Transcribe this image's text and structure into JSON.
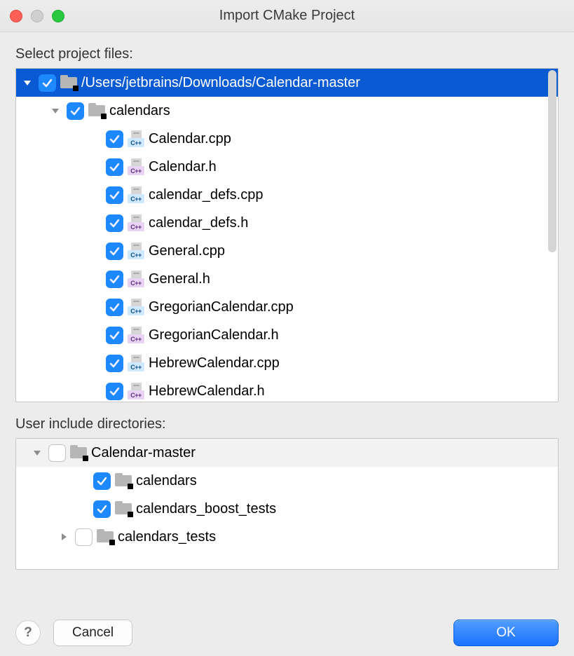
{
  "window": {
    "title": "Import CMake Project"
  },
  "sections": {
    "project_files_label": "Select project files:",
    "include_dirs_label": "User include directories:"
  },
  "project_tree": {
    "root": {
      "label": "/Users/jetbrains/Downloads/Calendar-master",
      "checked": true,
      "folders": [
        {
          "label": "calendars",
          "checked": true,
          "files": [
            {
              "label": "Calendar.cpp",
              "type": "cpp",
              "checked": true
            },
            {
              "label": "Calendar.h",
              "type": "h",
              "checked": true
            },
            {
              "label": "calendar_defs.cpp",
              "type": "cpp",
              "checked": true
            },
            {
              "label": "calendar_defs.h",
              "type": "h",
              "checked": true
            },
            {
              "label": "General.cpp",
              "type": "cpp",
              "checked": true
            },
            {
              "label": "General.h",
              "type": "h",
              "checked": true
            },
            {
              "label": "GregorianCalendar.cpp",
              "type": "cpp",
              "checked": true
            },
            {
              "label": "GregorianCalendar.h",
              "type": "h",
              "checked": true
            },
            {
              "label": "HebrewCalendar.cpp",
              "type": "cpp",
              "checked": true
            },
            {
              "label": "HebrewCalendar.h",
              "type": "h",
              "checked": true
            }
          ]
        }
      ]
    }
  },
  "include_tree": {
    "root": {
      "label": "Calendar-master",
      "checked": false,
      "children": [
        {
          "label": "calendars",
          "checked": true,
          "expandable": false
        },
        {
          "label": "calendars_boost_tests",
          "checked": true,
          "expandable": false
        },
        {
          "label": "calendars_tests",
          "checked": false,
          "expandable": true
        }
      ]
    }
  },
  "footer": {
    "help_label": "?",
    "cancel_label": "Cancel",
    "ok_label": "OK"
  },
  "icons": {
    "cxx_badge": "C++",
    "h_badge": "C++"
  }
}
